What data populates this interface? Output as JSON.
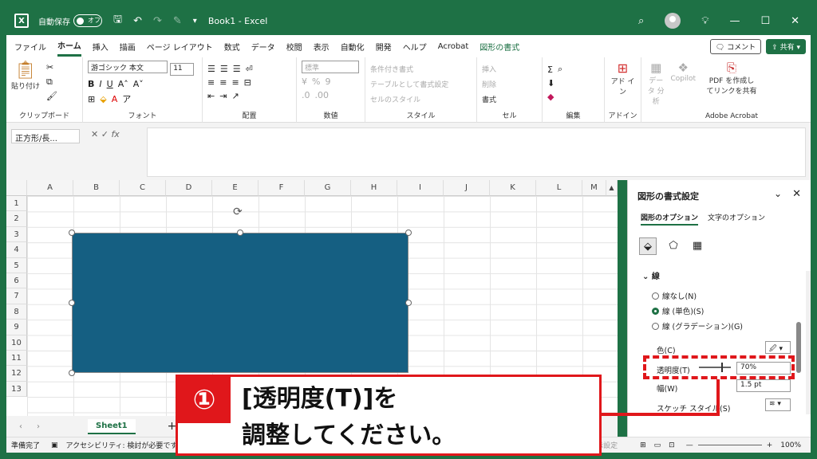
{
  "titlebar": {
    "logo": "X",
    "autosave_label": "自動保存",
    "autosave_state": "オフ",
    "title": "Book1 - Excel",
    "icons": [
      "excel-logo-icon",
      "save-icon",
      "undo-icon",
      "redo-icon",
      "brush-icon",
      "more-icon",
      "search-icon",
      "avatar",
      "lightbulb-icon",
      "minimize-icon",
      "maximize-icon",
      "close-icon"
    ],
    "min": "—",
    "max": "☐",
    "close": "✕"
  },
  "menubar": {
    "tabs": [
      "ファイル",
      "ホーム",
      "挿入",
      "描画",
      "ページ レイアウト",
      "数式",
      "データ",
      "校閲",
      "表示",
      "自動化",
      "開発",
      "ヘルプ",
      "Acrobat",
      "図形の書式"
    ],
    "comment": "コメント",
    "share": "共有"
  },
  "ribbon": {
    "clipboard": {
      "paste": "貼り付け",
      "label": "クリップボード"
    },
    "font": {
      "name": "游ゴシック 本文",
      "size": "11",
      "label": "フォント"
    },
    "align": {
      "label": "配置"
    },
    "number": {
      "format": "標準",
      "label": "数値"
    },
    "style": {
      "cond": "条件付き書式",
      "table": "テーブルとして書式設定",
      "cell": "セルのスタイル",
      "label": "スタイル"
    },
    "cells": {
      "insert": "挿入",
      "delete": "削除",
      "format": "書式",
      "label": "セル"
    },
    "edit": {
      "label": "編集"
    },
    "addin": {
      "btn": "アド イン",
      "label": "アドイン"
    },
    "data_analysis": "データ 分析",
    "copilot": "Copilot",
    "acrobat": {
      "btn": "PDF を作成し てリンクを共有",
      "label": "Adobe Acrobat"
    }
  },
  "formula_bar": {
    "name_box": "正方形/長...",
    "fx": "fx"
  },
  "grid": {
    "columns": [
      "A",
      "B",
      "C",
      "D",
      "E",
      "F",
      "G",
      "H",
      "I",
      "J",
      "K",
      "L",
      "M"
    ],
    "rows": [
      "1",
      "2",
      "3",
      "4",
      "5",
      "6",
      "7",
      "8",
      "9",
      "10",
      "11",
      "12",
      "13"
    ]
  },
  "sheetbar": {
    "sheet": "Sheet1",
    "add": "+"
  },
  "statusbar": {
    "ready": "準備完了",
    "accessibility": "アクセシビリティ: 検討が必要です",
    "display": "表示設定",
    "zoom": "100%"
  },
  "panel": {
    "title": "図形の書式設定",
    "tab_shape": "図形のオプション",
    "tab_text": "文字のオプション",
    "section": "線",
    "opt_none": "線なし(N)",
    "opt_solid": "線 (単色)(S)",
    "opt_grad": "線 (グラデーション)(G)",
    "color_label": "色(C)",
    "transparency_label": "透明度(T)",
    "transparency_value": "70%",
    "width_label": "幅(W)",
    "width_value": "1.5 pt",
    "sketch_label": "スケッチ スタイル(S)",
    "transparency_level": 0.7
  },
  "callout": {
    "badge": "①",
    "line1": "[透明度(T)]を",
    "line2": "調整してください。"
  },
  "colors": {
    "excel_green": "#1e7145",
    "shape_fill": "#155f82",
    "callout_red": "#e0171b"
  }
}
